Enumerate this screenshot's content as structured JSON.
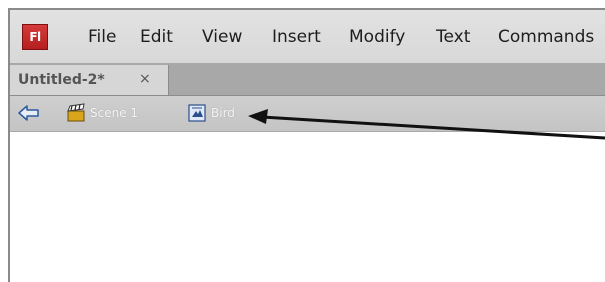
{
  "app": {
    "logo_text": "Fl"
  },
  "menu": {
    "items": [
      "File",
      "Edit",
      "View",
      "Insert",
      "Modify",
      "Text",
      "Commands"
    ]
  },
  "document_tab": {
    "label": "Untitled-2*",
    "close_label": "×"
  },
  "edit_bar": {
    "scene_label": "Scene 1",
    "symbol_label": "Bird"
  }
}
